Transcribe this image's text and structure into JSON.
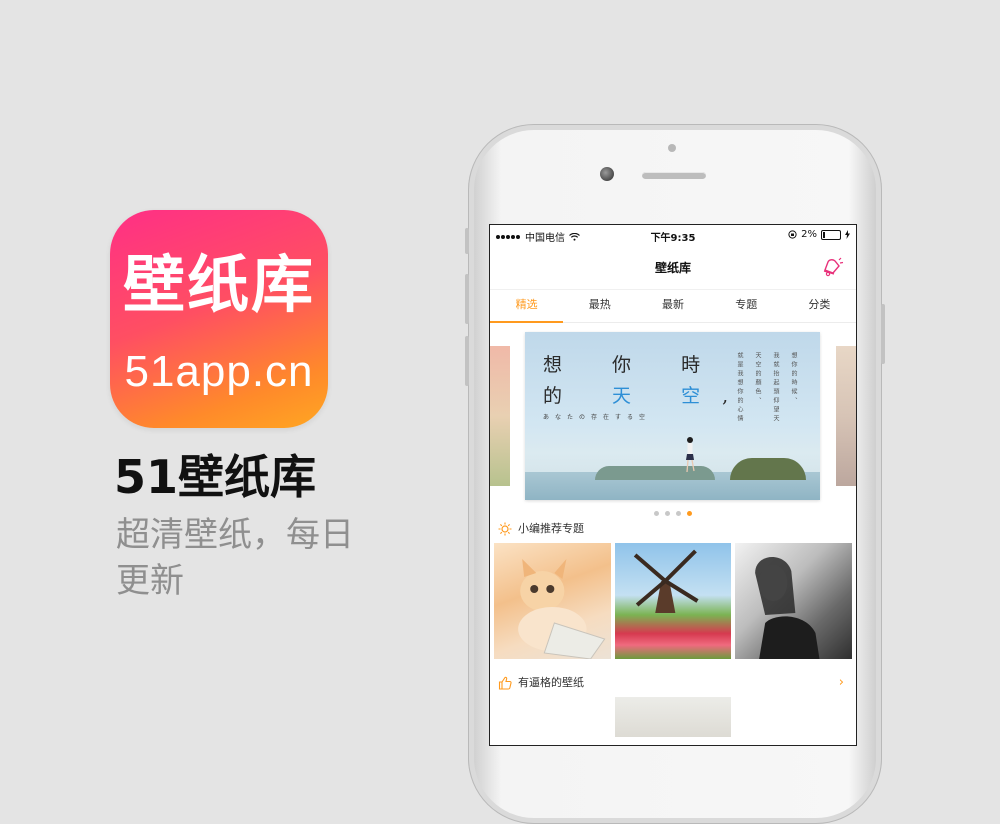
{
  "promo": {
    "icon_name": "壁纸库",
    "icon_domain": "51app.cn",
    "title": "51壁纸库",
    "description": "超清壁纸，每日更新"
  },
  "status_bar": {
    "carrier": "中国电信",
    "time": "下午9:35",
    "battery": "2%"
  },
  "navbar": {
    "title": "壁纸库",
    "right_icon": "bell-icon"
  },
  "tabs": [
    {
      "label": "精选",
      "active": true
    },
    {
      "label": "最热",
      "active": false
    },
    {
      "label": "最新",
      "active": false
    },
    {
      "label": "专题",
      "active": false
    },
    {
      "label": "分类",
      "active": false
    }
  ],
  "banner": {
    "line1": "想 你 時",
    "line2_a": "的 ",
    "line2_b": "天 空",
    "line2_c": ",",
    "small": "あなたの存在する空",
    "vertical_1": "想你的時候、",
    "vertical_2": "我就抬起頭仰望天",
    "vertical_3": "天空的顏色、",
    "vertical_4": "就是我想你的心情",
    "pager": {
      "count": 4,
      "active": 3
    }
  },
  "sections": {
    "featured_title": "小编推荐专题",
    "featured_icon": "sun-icon",
    "cool_title": "有逼格的壁纸",
    "cool_icon": "thumbs-up-icon"
  },
  "colors": {
    "accent": "#ff9a1e",
    "icon_gradient_start": "#ff2f86",
    "icon_gradient_end": "#ffa722",
    "bell": "#e8317a"
  }
}
